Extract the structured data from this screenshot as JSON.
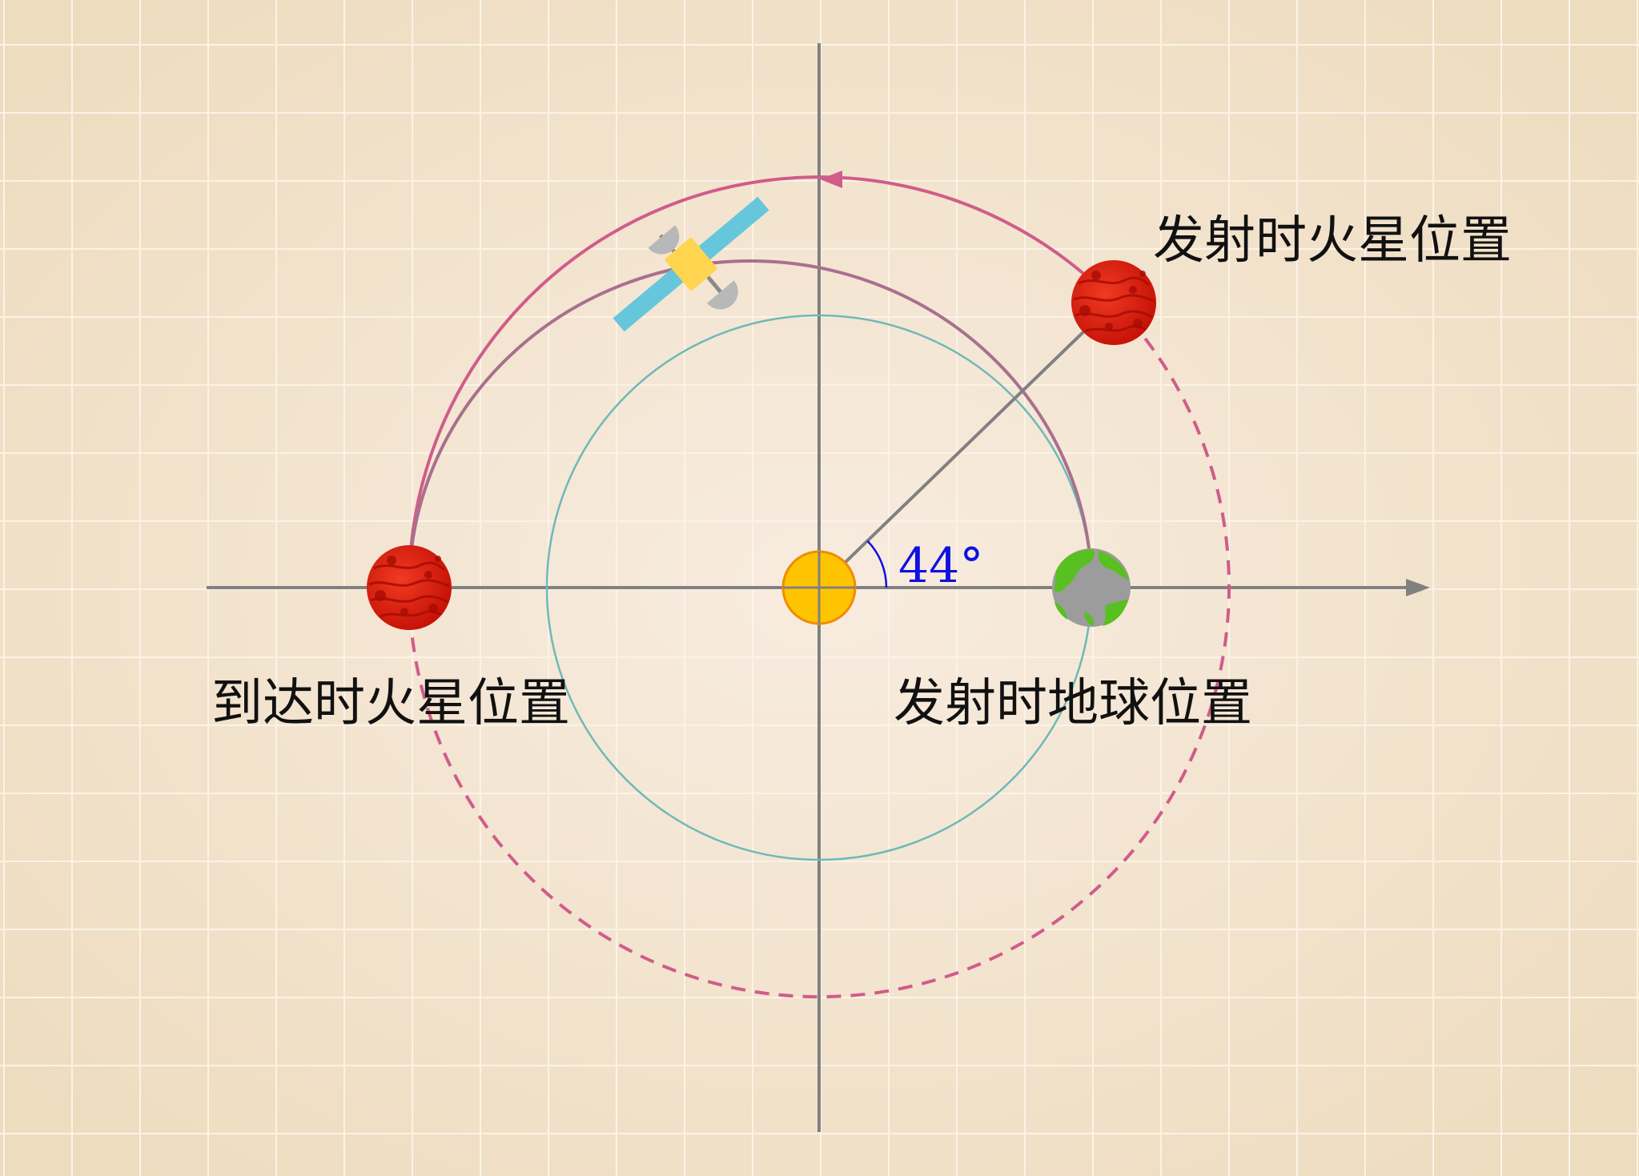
{
  "labels": {
    "launch_mars": "发射时火星位置",
    "arrival_mars": "到达时火星位置",
    "launch_earth": "发射时地球位置",
    "angle": "44°"
  },
  "angle_value_deg": 44,
  "colors": {
    "background": "#f2dfc4",
    "background_center": "#f8ece0",
    "grid": "#fbf3e6",
    "axis": "#808080",
    "earth_orbit": "#6fb8b8",
    "mars_orbit": "#d05c8a",
    "transfer_orbit": "#a8708e",
    "angle_text": "#1010e0",
    "sun": "#ffc400",
    "sun_edge": "#f08c00",
    "mars": "#e02010",
    "earth_land": "#58c020",
    "earth_ocean": "#999999",
    "satellite_panel": "#66c6dc",
    "satellite_body": "#ffd54f",
    "label_text": "#111111"
  },
  "icons": [
    "sun-icon",
    "earth-icon",
    "mars-icon",
    "satellite-icon"
  ]
}
